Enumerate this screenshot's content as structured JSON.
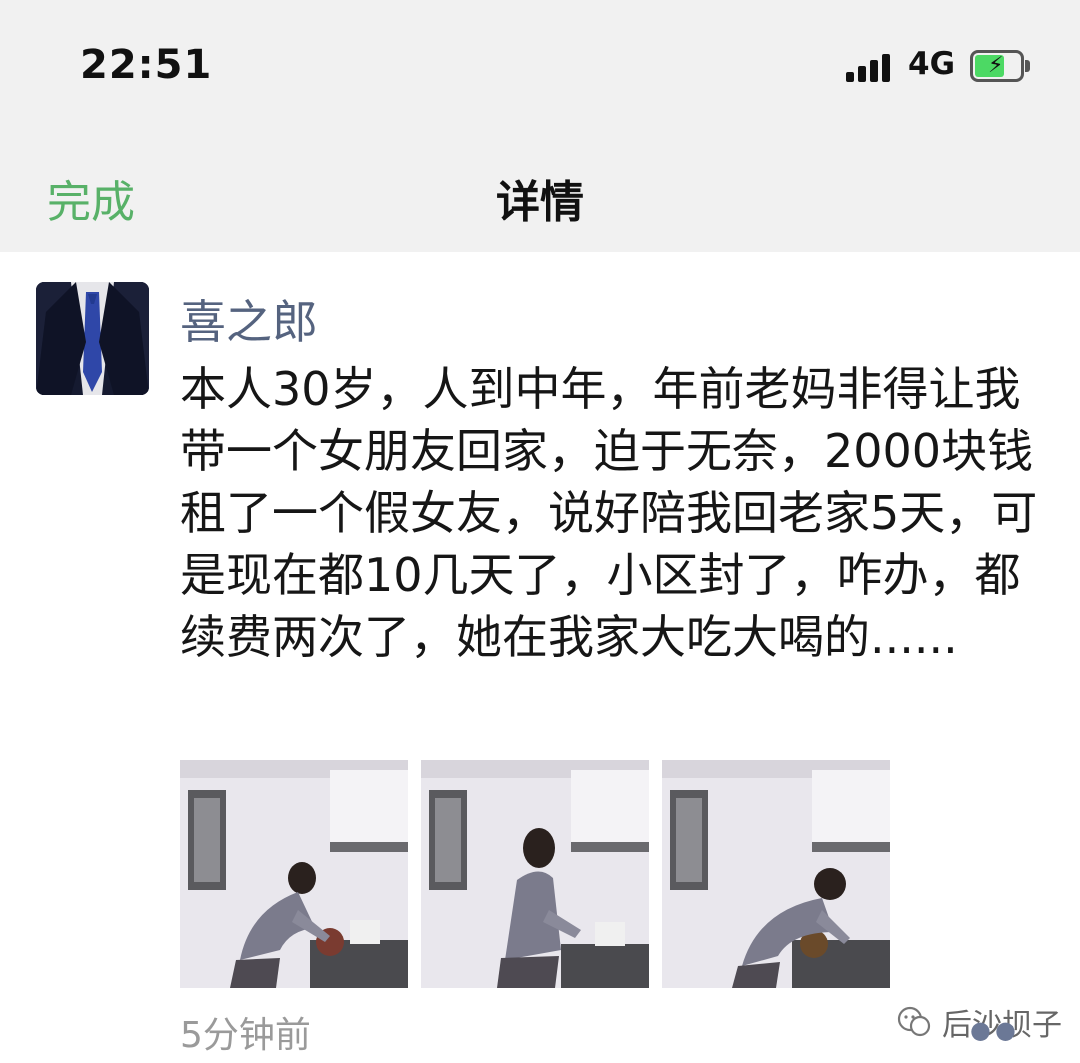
{
  "status_bar": {
    "time": "22:51",
    "network": "4G",
    "signal_icon": "signal-bars-icon",
    "battery_icon": "battery-charging-icon",
    "battery_level": 0.65,
    "battery_color": "#4cd964"
  },
  "nav": {
    "done_label": "完成",
    "title": "详情",
    "accent_color": "#58b168"
  },
  "post": {
    "author": "喜之郎",
    "text": "本人30岁，人到中年，年前老妈非得让我带一个女朋友回家，迫于无奈，2000块钱租了一个假女友，说好陪我回老家5天，可是现在都10几天了，小区封了，咋办，都续费两次了，她在我家大吃大喝的......",
    "photos": [
      {
        "icon": "kitchen-photo"
      },
      {
        "icon": "kitchen-photo"
      },
      {
        "icon": "kitchen-photo"
      }
    ],
    "time": "5分钟前",
    "name_color": "#55637f"
  },
  "watermark": {
    "text": "后沙坝子",
    "icon": "wechat-official-account-icon"
  }
}
